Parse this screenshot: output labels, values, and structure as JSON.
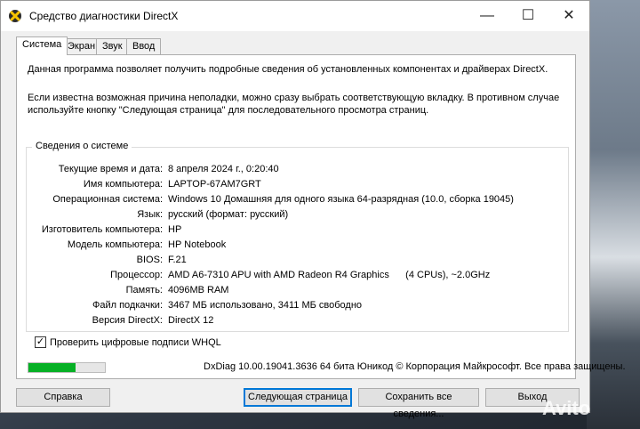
{
  "window": {
    "title": "Средство диагностики DirectX"
  },
  "tabs": [
    "Система",
    "Экран",
    "Звук",
    "Ввод"
  ],
  "intro": {
    "p1": "Данная программа позволяет получить подробные сведения об установленных компонентах и драйверах DirectX.",
    "p2": "Если известна возможная причина неполадки, можно сразу выбрать соответствующую вкладку. В противном случае используйте кнопку \"Следующая страница\" для последовательного просмотра страниц."
  },
  "system_info": {
    "title": "Сведения о системе",
    "rows": [
      {
        "label": "Текущие время и дата:",
        "value": "8 апреля 2024 г., 0:20:40"
      },
      {
        "label": "Имя компьютера:",
        "value": "LAPTOP-67AM7GRT"
      },
      {
        "label": "Операционная система:",
        "value": "Windows 10 Домашняя для одного языка 64-разрядная (10.0, сборка 19045)"
      },
      {
        "label": "Язык:",
        "value": "русский (формат: русский)"
      },
      {
        "label": "Изготовитель компьютера:",
        "value": "HP"
      },
      {
        "label": "Модель компьютера:",
        "value": "HP Notebook"
      },
      {
        "label": "BIOS:",
        "value": "F.21"
      },
      {
        "label": "Процессор:",
        "value": "AMD A6-7310 APU with AMD Radeon R4 Graphics      (4 CPUs), ~2.0GHz"
      },
      {
        "label": "Память:",
        "value": "4096MB RAM"
      },
      {
        "label": "Файл подкачки:",
        "value": "3467 МБ использовано, 3411 МБ свободно"
      },
      {
        "label": "Версия DirectX:",
        "value": "DirectX 12"
      }
    ]
  },
  "whql": {
    "label": "Проверить цифровые подписи WHQL",
    "checked": "✓"
  },
  "progress": {
    "value": 0.62,
    "color": "#06b025"
  },
  "footer": {
    "text": "DxDiag 10.00.19041.3636 64 бита Юникод  © Корпорация Майкрософт. Все права защищены."
  },
  "buttons": {
    "help": "Справка",
    "next": "Следующая страница",
    "save": "Сохранить все сведения...",
    "exit": "Выход"
  },
  "watermark": "Avito",
  "icons": {
    "app": "directx-icon",
    "minimize": "minimize-icon",
    "maximize": "maximize-icon",
    "close": "close-icon",
    "check": "checkmark-icon"
  }
}
